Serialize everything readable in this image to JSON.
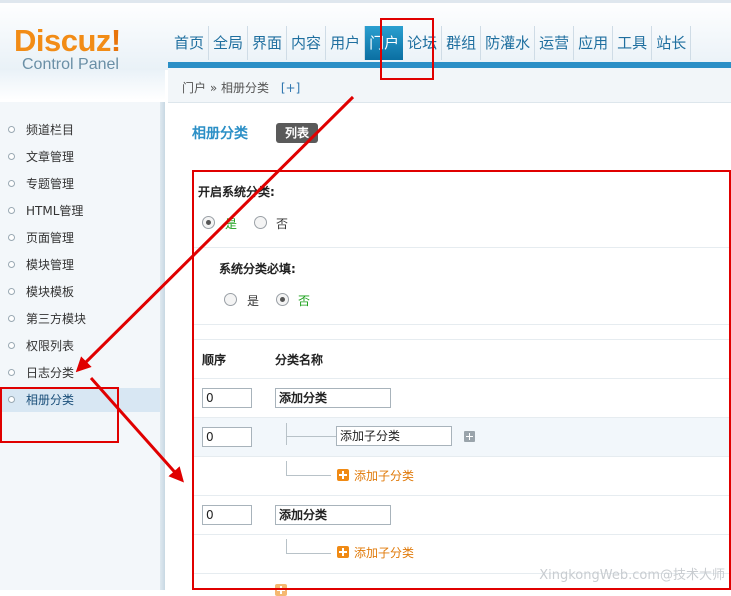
{
  "logo": {
    "word": "Discuz",
    "bang": "!",
    "sub": "Control Panel"
  },
  "nav": [
    "首页",
    "全局",
    "界面",
    "内容",
    "用户",
    "门户",
    "论坛",
    "群组",
    "防灌水",
    "运营",
    "应用",
    "工具",
    "站长"
  ],
  "breadcrumb": {
    "home": "门户",
    "sep": "»",
    "current": "相册分类",
    "add": "[+]"
  },
  "sidebar": [
    "频道栏目",
    "文章管理",
    "专题管理",
    "HTML管理",
    "页面管理",
    "模块管理",
    "模块模板",
    "第三方模块",
    "权限列表",
    "日志分类",
    "相册分类"
  ],
  "page": {
    "title": "相册分类",
    "tab": "列表"
  },
  "form": {
    "enable_label": "开启系统分类:",
    "required_label": "系统分类必填:",
    "yes": "是",
    "no": "否"
  },
  "table": {
    "col_order": "顺序",
    "col_name": "分类名称",
    "rows": [
      {
        "order": "0",
        "name": "添加分类",
        "bold": true
      },
      {
        "order": "0",
        "name": "添加子分类",
        "bold": false
      },
      {
        "order": "0",
        "name": "添加分类",
        "bold": true
      }
    ],
    "add_sub": "添加子分类"
  },
  "watermark": "XingkongWeb.com@技术大师",
  "colors": {
    "accent": "#2b8fc6",
    "annotation": "#e00000",
    "add": "#e07a0a",
    "selected_green": "#1aa01a"
  }
}
